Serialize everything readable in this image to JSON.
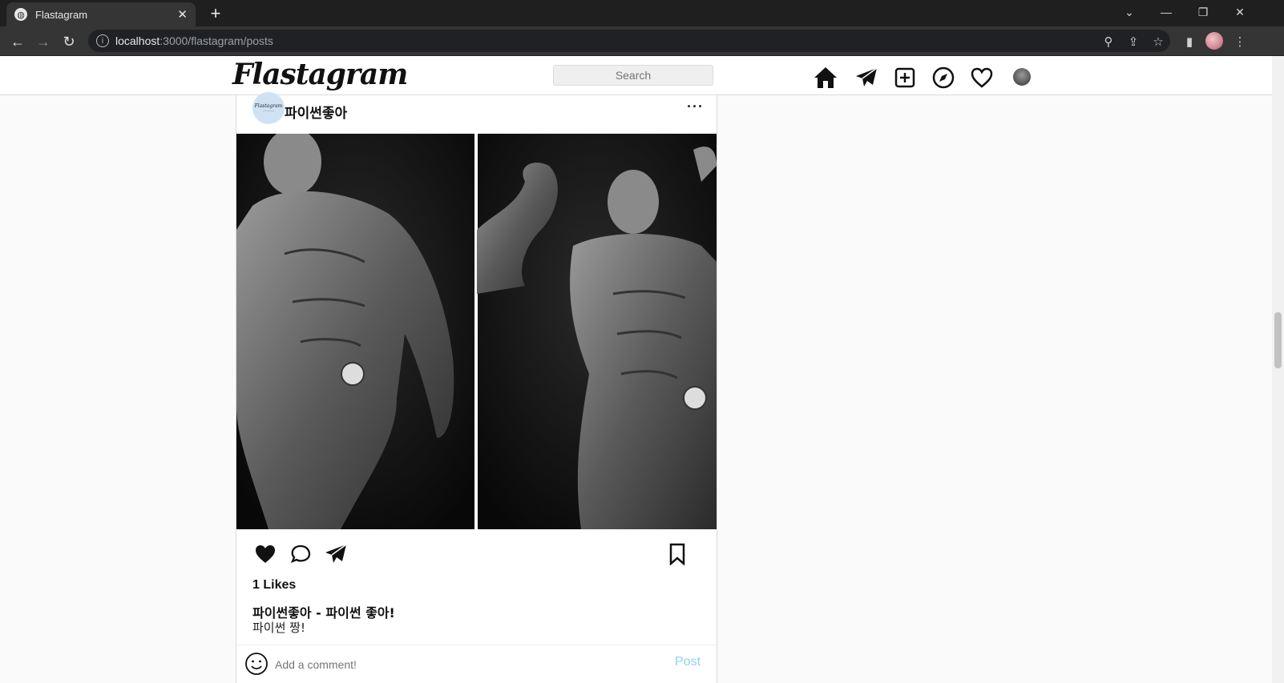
{
  "browser": {
    "tab_title": "Flastagram",
    "tab_favicon_icon": "globe-icon",
    "url_host": "localhost",
    "url_path": ":3000/flastagram/posts"
  },
  "header": {
    "logo_text": "Flastagram",
    "search_placeholder": "Search",
    "nav_icons": [
      "home-icon",
      "paper-plane-icon",
      "plus-square-icon",
      "compass-icon",
      "heart-outline-icon",
      "profile-avatar"
    ]
  },
  "post": {
    "username": "파이썬좋아",
    "avatar_logo_text": "Flastagram",
    "more_label": "···",
    "likes_label": "1 Likes",
    "caption_user": "파이썬좋아",
    "caption_title": " - 파이썬 좋아!",
    "caption_body": "파이썬 짱!",
    "comment_placeholder": "Add a comment!",
    "post_label": "Post"
  },
  "colors": {
    "post_button": "#8fd2ef",
    "border": "#dbdbdb",
    "page_bg": "#fafafa"
  }
}
